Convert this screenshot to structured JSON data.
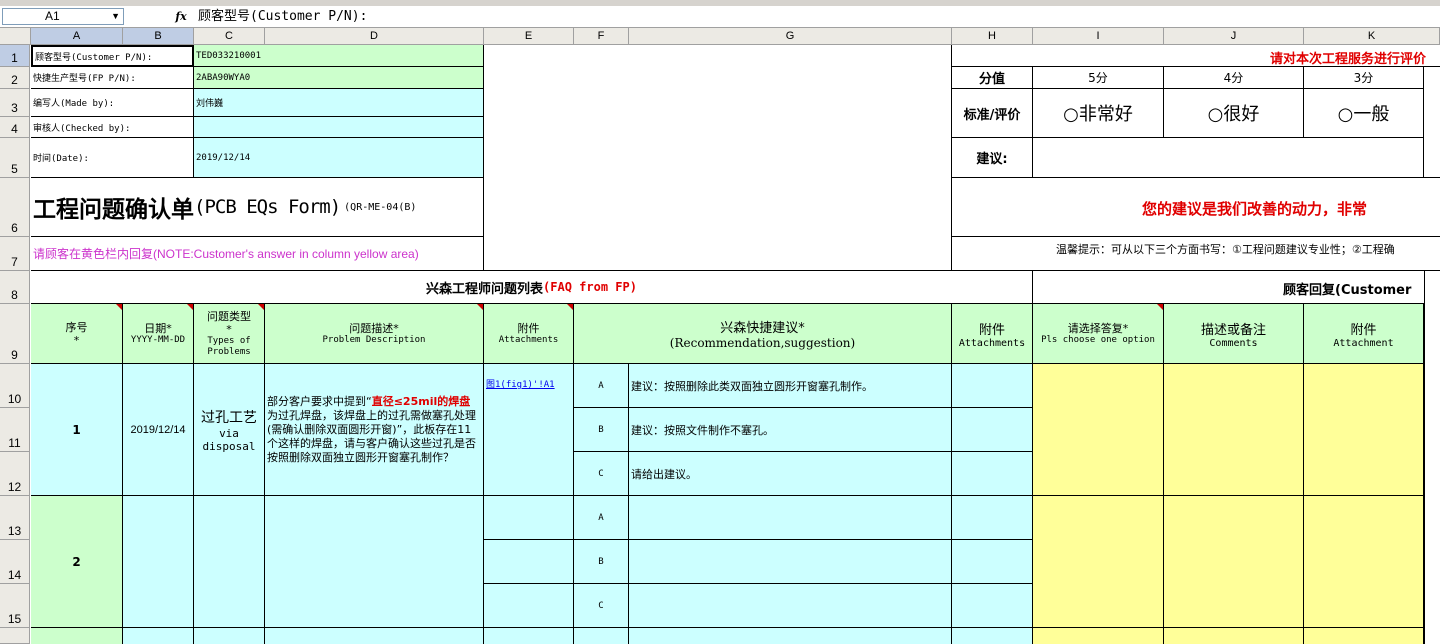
{
  "formula_bar": {
    "name_box": "A1",
    "fx_label": "fx",
    "content": "顾客型号(Customer P/N):"
  },
  "columns": [
    "A",
    "B",
    "C",
    "D",
    "E",
    "F",
    "G",
    "H",
    "I",
    "J",
    "K"
  ],
  "rows": [
    "1",
    "2",
    "3",
    "4",
    "5",
    "6",
    "7",
    "8",
    "9",
    "10",
    "11",
    "12",
    "13",
    "14",
    "15"
  ],
  "info": {
    "customer_pn_label": "顾客型号(Customer P/N):",
    "customer_pn_value": "TED033210001",
    "fp_pn_label": "快捷生产型号(FP P/N):",
    "fp_pn_value": "2ABA90WYA0",
    "made_by_label": "编写人(Made by):",
    "made_by_value": "刘伟巍",
    "checked_by_label": "审核人(Checked by):",
    "checked_by_value": "",
    "date_label": "时间(Date):",
    "date_value": "2019/12/14"
  },
  "form_title": {
    "main": "工程问题确认单",
    "english": "(PCB EQs Form)",
    "code": "(QR-ME-04(B)"
  },
  "note": "请顾客在黄色栏内回复(NOTE:Customer's answer in column yellow area)",
  "feedback": {
    "header": "请对本次工程服务进行评价",
    "score_label": "分值",
    "scores": [
      "5分",
      "4分",
      "3分"
    ],
    "standard_label": "标准/评价",
    "options": [
      "○非常好",
      "○很好",
      "○一般"
    ],
    "suggest_label": "建议:",
    "motto": "您的建议是我们改善的动力，非常",
    "tip": "温馨提示：可从以下三个方面书写：①工程问题建议专业性；②工程确"
  },
  "faq": {
    "title": "兴森工程师问题列表",
    "title_en": "(FAQ from FP)",
    "customer_title": "顾客回复(Customer"
  },
  "table_headers": {
    "seq": "序号",
    "seq_sub": "*",
    "date": "日期*",
    "date_sub": "YYYY-MM-DD",
    "type": "问题类型*",
    "type_sub": "Types of Problems",
    "desc": "问题描述*",
    "desc_sub": "Problem Description",
    "attach": "附件",
    "attach_sub": "Attachments",
    "recommend": "兴森快捷建议*",
    "recommend_sub": "(Recommendation,suggestion)",
    "attach2": "附件",
    "attach2_sub": "Attachments",
    "choose": "请选择答复*",
    "choose_sub": "Pls choose one option",
    "comments": "描述或备注",
    "comments_sub": "Comments",
    "attach3": "附件",
    "attach3_sub": "Attachment"
  },
  "issues": [
    {
      "seq": "1",
      "date": "2019/12/14",
      "type": "过孔工艺",
      "type_en": "via disposal",
      "desc_pre": "部分客户要求中提到“",
      "desc_red": "直径≤25mil的焊盘",
      "desc_post": "为过孔焊盘，该焊盘上的过孔需做塞孔处理(需确认删除双面圆形开窗)”，此板存在11个这样的焊盘，请与客户确认这些过孔是否按照删除双面独立圆形开窗塞孔制作？",
      "attachment_link": "图1(fig1)'!A1",
      "options": [
        {
          "letter": "A",
          "text": "建议：按照删除此类双面独立圆形开窗塞孔制作。"
        },
        {
          "letter": "B",
          "text": "建议：按照文件制作不塞孔。"
        },
        {
          "letter": "C",
          "text": "请给出建议。"
        }
      ]
    },
    {
      "seq": "2",
      "date": "",
      "type": "",
      "type_en": "",
      "desc_pre": "",
      "desc_red": "",
      "desc_post": "",
      "attachment_link": "",
      "options": [
        {
          "letter": "A",
          "text": ""
        },
        {
          "letter": "B",
          "text": ""
        },
        {
          "letter": "C",
          "text": ""
        }
      ]
    }
  ]
}
